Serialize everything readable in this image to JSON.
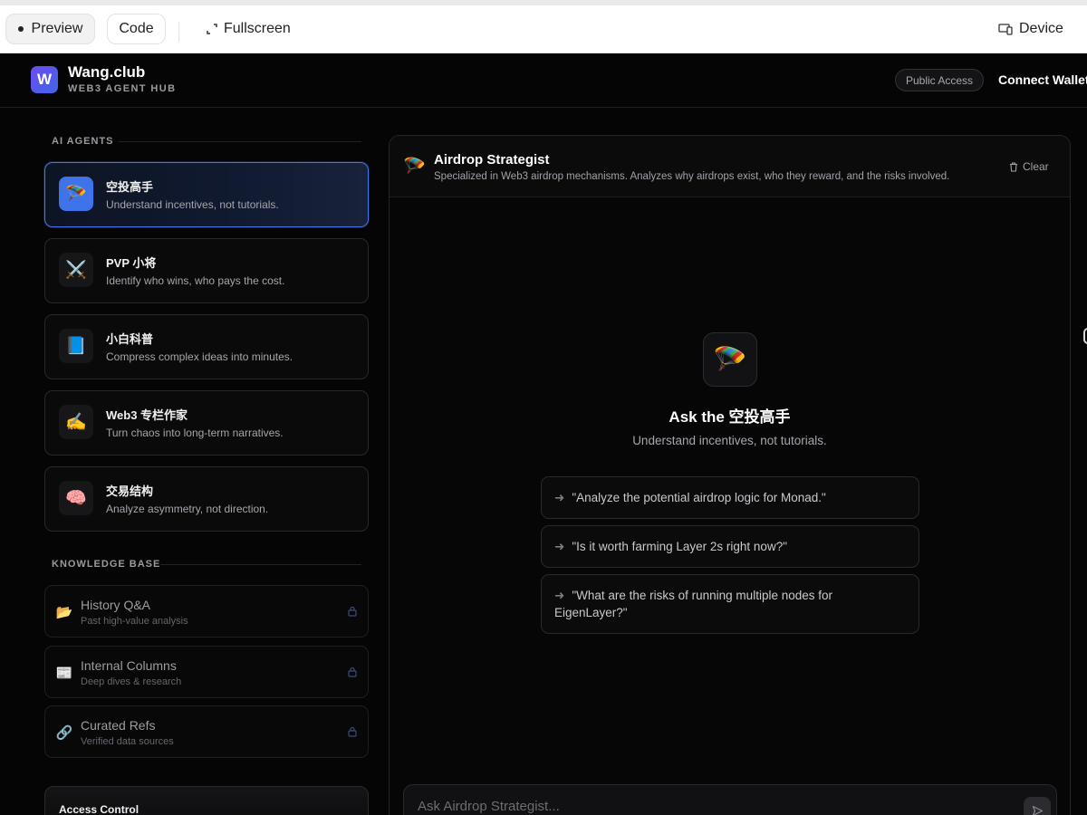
{
  "toolbar": {
    "preview_label": "Preview",
    "code_label": "Code",
    "fullscreen_label": "Fullscreen",
    "device_label": "Device"
  },
  "header": {
    "logo_letter": "W",
    "title": "Wang.club",
    "subtitle": "WEB3 AGENT HUB",
    "public_badge": "Public Access",
    "connect_label": "Connect Wallet"
  },
  "sidebar": {
    "agents_label": "AI AGENTS",
    "agents": [
      {
        "icon": "🪂",
        "name": "空投高手",
        "desc": "Understand incentives, not tutorials."
      },
      {
        "icon": "⚔️",
        "name": "PVP 小将",
        "desc": "Identify who wins, who pays the cost."
      },
      {
        "icon": "📘",
        "name": "小白科普",
        "desc": "Compress complex ideas into minutes."
      },
      {
        "icon": "✍️",
        "name": "Web3 专栏作家",
        "desc": "Turn chaos into long-term narratives."
      },
      {
        "icon": "🧠",
        "name": "交易结构",
        "desc": "Analyze asymmetry, not direction."
      }
    ],
    "kb_label": "KNOWLEDGE BASE",
    "kb": [
      {
        "icon": "📂",
        "name": "History Q&A",
        "desc": "Past high-value analysis"
      },
      {
        "icon": "📰",
        "name": "Internal Columns",
        "desc": "Deep dives & research"
      },
      {
        "icon": "🔗",
        "name": "Curated Refs",
        "desc": "Verified data sources"
      }
    ],
    "access_title": "Access Control"
  },
  "chat": {
    "icon": "🪂",
    "title": "Airdrop Strategist",
    "subtitle": "Specialized in Web3 airdrop mechanisms. Analyzes why airdrops exist, who they reward, and the risks involved.",
    "clear_label": "Clear",
    "hero_icon": "🪂",
    "hero_title": "Ask the 空投高手",
    "hero_sub": "Understand incentives, not tutorials.",
    "suggestions": [
      "\"Analyze the potential airdrop logic for Monad.\"",
      "\"Is it worth farming Layer 2s right now?\"",
      "\"What are the risks of running multiple nodes for EigenLayer?\""
    ],
    "arrow": "➜",
    "input_placeholder": "Ask Airdrop Strategist..."
  }
}
